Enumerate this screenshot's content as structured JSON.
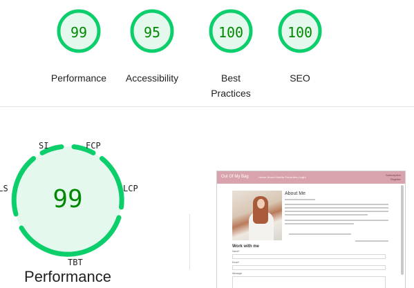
{
  "categories": [
    {
      "score": "99",
      "label": "Performance",
      "fraction": 0.99
    },
    {
      "score": "95",
      "label": "Accessibility",
      "fraction": 0.95
    },
    {
      "score": "100",
      "label": "Best Practices",
      "fraction": 1.0
    },
    {
      "score": "100",
      "label": "SEO",
      "fraction": 1.0
    }
  ],
  "performance": {
    "score": "99",
    "title": "Performance",
    "metrics": {
      "si": "SI",
      "fcp": "FCP",
      "lcp": "LCP",
      "tbt": "TBT",
      "cls": "CLS"
    }
  },
  "colors": {
    "pass": "#0cce6b",
    "pass_bg": "#e5f8ee",
    "pass_text": "#008800"
  },
  "thumbnail": {
    "brand": "Out Of My Bag",
    "nav_links": "Home   About   Media   Favorites   Login",
    "right_line1": "Subscription",
    "right_line2": "Register",
    "heading": "About Me",
    "section": "Work with me",
    "label_name": "Name*",
    "label_email": "Email*",
    "label_message": "Message"
  }
}
